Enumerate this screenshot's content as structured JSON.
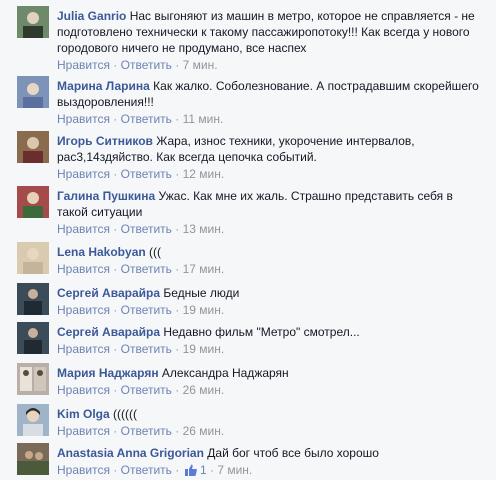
{
  "labels": {
    "like": "Нравится",
    "reply": "Ответить",
    "dot": "·"
  },
  "comments": [
    {
      "author": "Julia Ganrio",
      "text": "Нас выгоняют из машин в метро, которое не справляется - не подготовлено технически к такому пассажиропотоку!!! Как всегда у нового городового ничего не продумано, все наспех",
      "time": "7 мин.",
      "avatar_color": "#6f8a6a"
    },
    {
      "author": "Марина Ларина",
      "text": "Как жалко. Соболезнование. А пострадавшим скорейшего выздоровления!!!",
      "time": "11 мин.",
      "avatar_color": "#7e93b8"
    },
    {
      "author": "Игорь Ситников",
      "text": "Жара, износ техники, укорочение интервалов, рас3,14здяйство. Как всегда цепочка событий.",
      "time": "12 мин.",
      "avatar_color": "#8a6b4e"
    },
    {
      "author": "Галина Пушкина",
      "text": "Ужас. Как мне их жаль. Страшно представить себя в такой ситуации",
      "time": "13 мин.",
      "avatar_color": "#a64b4b"
    },
    {
      "author": "Lena Hakobyan",
      "text": "(((",
      "time": "17 мин.",
      "avatar_color": "#d9cbb0"
    },
    {
      "author": "Сергей Аварайра",
      "text": "Бедные люди",
      "time": "19 мин.",
      "avatar_color": "#3b4b57"
    },
    {
      "author": "Сергей Аварайра",
      "text": "Недавно фильм \"Метро\" смотрел...",
      "time": "19 мин.",
      "avatar_color": "#3b4b57"
    },
    {
      "author": "Мария Наджарян",
      "text": "Александра Наджарян",
      "time": "26 мин.",
      "avatar_color": "#b8b0a8"
    },
    {
      "author": "Kim Olga",
      "text": "((((((",
      "time": "26 мин.",
      "avatar_color": "#a0b4c8"
    },
    {
      "author": "Anastasia Anna Grigorian",
      "text": "Дай бог чтоб все было хорошо",
      "time": "7 мин.",
      "avatar_color": "#7a6a5a",
      "likes": "1"
    }
  ]
}
